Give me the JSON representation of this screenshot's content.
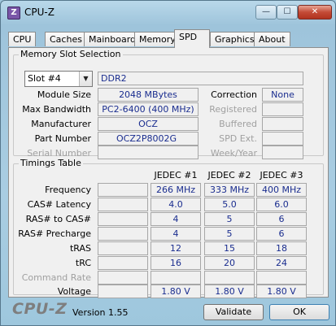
{
  "window": {
    "title": "CPU-Z",
    "app_icon_letter": "Z",
    "minimize": "—",
    "maximize": "☐",
    "close": "✕"
  },
  "tabs": [
    "CPU",
    "Caches",
    "Mainboard",
    "Memory",
    "SPD",
    "Graphics",
    "About"
  ],
  "active_tab": "SPD",
  "memory_slot": {
    "group_label": "Memory Slot Selection",
    "slot_selected": "Slot #4",
    "type": "DDR2",
    "module_size_label": "Module Size",
    "module_size": "2048 MBytes",
    "max_bandwidth_label": "Max Bandwidth",
    "max_bandwidth": "PC2-6400 (400 MHz)",
    "manufacturer_label": "Manufacturer",
    "manufacturer": "OCZ",
    "part_number_label": "Part Number",
    "part_number": "OCZ2P8002G",
    "serial_number_label": "Serial Number",
    "serial_number": "",
    "correction_label": "Correction",
    "correction": "None",
    "registered_label": "Registered",
    "registered": "",
    "buffered_label": "Buffered",
    "buffered": "",
    "spd_ext_label": "SPD Ext.",
    "spd_ext": "",
    "week_year_label": "Week/Year",
    "week_year": ""
  },
  "timings": {
    "group_label": "Timings Table",
    "columns": [
      "JEDEC #1",
      "JEDEC #2",
      "JEDEC #3"
    ],
    "rows": [
      {
        "label": "Frequency",
        "disabled": false,
        "values": [
          "266 MHz",
          "333 MHz",
          "400 MHz"
        ]
      },
      {
        "label": "CAS# Latency",
        "disabled": false,
        "values": [
          "4.0",
          "5.0",
          "6.0"
        ]
      },
      {
        "label": "RAS# to CAS#",
        "disabled": false,
        "values": [
          "4",
          "5",
          "6"
        ]
      },
      {
        "label": "RAS# Precharge",
        "disabled": false,
        "values": [
          "4",
          "5",
          "6"
        ]
      },
      {
        "label": "tRAS",
        "disabled": false,
        "values": [
          "12",
          "15",
          "18"
        ]
      },
      {
        "label": "tRC",
        "disabled": false,
        "values": [
          "16",
          "20",
          "24"
        ]
      },
      {
        "label": "Command Rate",
        "disabled": true,
        "values": [
          "",
          "",
          ""
        ]
      },
      {
        "label": "Voltage",
        "disabled": false,
        "values": [
          "1.80 V",
          "1.80 V",
          "1.80 V"
        ]
      }
    ]
  },
  "footer": {
    "brand": "CPU-Z",
    "version": "Version 1.55",
    "validate_label": "Validate",
    "ok_label": "OK"
  }
}
